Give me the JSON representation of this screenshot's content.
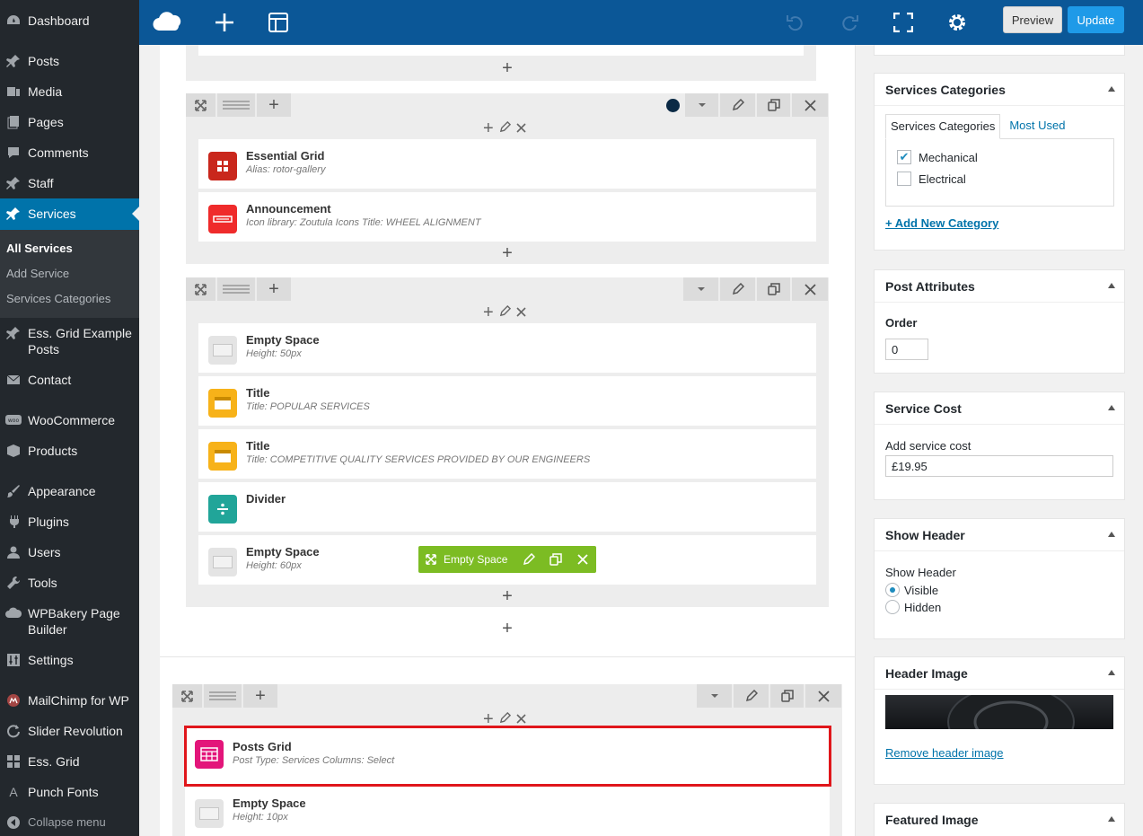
{
  "sidebar": {
    "items": [
      {
        "label": "Dashboard",
        "icon": "dashboard-icon"
      },
      {
        "label": "Posts",
        "icon": "pin-icon"
      },
      {
        "label": "Media",
        "icon": "media-icon"
      },
      {
        "label": "Pages",
        "icon": "pages-icon"
      },
      {
        "label": "Comments",
        "icon": "comments-icon"
      },
      {
        "label": "Staff",
        "icon": "pin-icon"
      },
      {
        "label": "Services",
        "icon": "pin-icon"
      },
      {
        "label": "Ess. Grid Example Posts",
        "icon": "pin-icon"
      },
      {
        "label": "Contact",
        "icon": "mail-icon"
      },
      {
        "label": "WooCommerce",
        "icon": "woo-icon"
      },
      {
        "label": "Products",
        "icon": "box-icon"
      },
      {
        "label": "Appearance",
        "icon": "brush-icon"
      },
      {
        "label": "Plugins",
        "icon": "plug-icon"
      },
      {
        "label": "Users",
        "icon": "user-icon"
      },
      {
        "label": "Tools",
        "icon": "wrench-icon"
      },
      {
        "label": "WPBakery Page Builder",
        "icon": "cloud-icon"
      },
      {
        "label": "Settings",
        "icon": "sliders-icon"
      },
      {
        "label": "MailChimp for WP",
        "icon": "mailchimp-icon"
      },
      {
        "label": "Slider Revolution",
        "icon": "refresh-icon"
      },
      {
        "label": "Ess. Grid",
        "icon": "grid-icon"
      },
      {
        "label": "Punch Fonts",
        "icon": "font-icon"
      },
      {
        "label": "Collapse menu",
        "icon": "collapse-icon"
      }
    ],
    "submenu": [
      "All Services",
      "Add Service",
      "Services Categories"
    ]
  },
  "toolbar": {
    "preview_label": "Preview",
    "update_label": "Update"
  },
  "editor": {
    "row1": {
      "elements": [
        {
          "title": "Essential Grid",
          "subtitle": "Alias: rotor-gallery"
        },
        {
          "title": "Announcement",
          "subtitle": "Icon library: Zoutula Icons  Title: WHEEL ALIGNMENT"
        }
      ]
    },
    "row2": {
      "elements": [
        {
          "title": "Empty Space",
          "subtitle": "Height: 50px"
        },
        {
          "title": "Title",
          "subtitle": "Title: POPULAR SERVICES"
        },
        {
          "title": "Title",
          "subtitle": "Title: COMPETITIVE QUALITY SERVICES PROVIDED BY OUR ENGINEERS"
        },
        {
          "title": "Divider",
          "subtitle": ""
        },
        {
          "title": "Empty Space",
          "subtitle": "Height: 60px"
        }
      ],
      "hover_label": "Empty Space"
    },
    "row3": {
      "elements": [
        {
          "title": "Posts Grid",
          "subtitle": "Post Type: Services  Columns: Select"
        },
        {
          "title": "Empty Space",
          "subtitle": "Height: 10px"
        }
      ]
    },
    "colors": {
      "row1_dot": "#0b2a45",
      "essential": "#c9271c",
      "announcement": "#ef2b2b",
      "title": "#f7b219",
      "divider": "#21a599",
      "posts_grid": "#e3157a",
      "hover_bar": "#7cbc23",
      "highlight": "#e0161b"
    }
  },
  "panels": {
    "categories": {
      "title": "Services Categories",
      "tab_all": "Services Categories",
      "tab_used": "Most Used",
      "items": [
        {
          "label": "Mechanical",
          "checked": true
        },
        {
          "label": "Electrical",
          "checked": false
        }
      ],
      "add_link": "+ Add New Category"
    },
    "attributes": {
      "title": "Post Attributes",
      "order_label": "Order",
      "order_value": "0"
    },
    "cost": {
      "title": "Service Cost",
      "label": "Add service cost",
      "value": "£19.95"
    },
    "header": {
      "title": "Show Header",
      "label": "Show Header",
      "options": [
        "Visible",
        "Hidden"
      ],
      "selected": "Visible"
    },
    "header_image": {
      "title": "Header Image",
      "remove_link": "Remove header image"
    },
    "featured": {
      "title": "Featured Image"
    }
  }
}
